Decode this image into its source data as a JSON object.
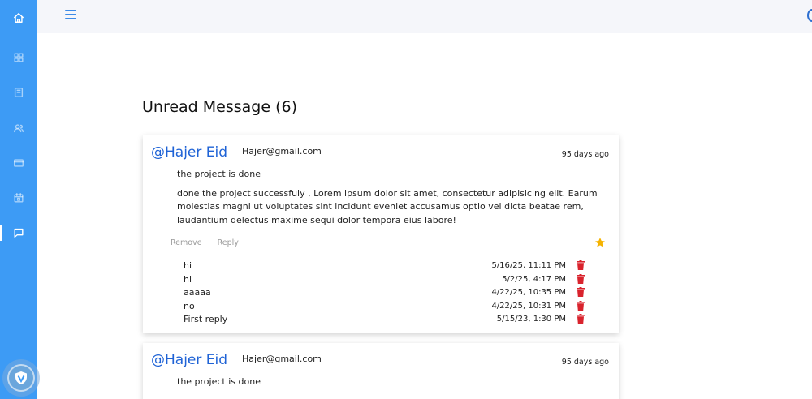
{
  "sidebar": {
    "items": [
      {
        "icon": "home-icon"
      },
      {
        "icon": "grid-icon"
      },
      {
        "icon": "book-icon"
      },
      {
        "icon": "users-icon"
      },
      {
        "icon": "card-icon"
      },
      {
        "icon": "calendar-icon"
      },
      {
        "icon": "message-icon"
      }
    ],
    "bottom_icon": "shield-icon",
    "accent": "#3d9bf5"
  },
  "page": {
    "title": "Unread Message (6)"
  },
  "messages": [
    {
      "username": "@Hajer Eid",
      "email": "Hajer@gmail.com",
      "ago": "95 days ago",
      "subject": "the project is done",
      "body": "done the project successfuly , Lorem ipsum dolor sit amet, consectetur adipisicing elit. Earum molestias magni ut voluptates sint incidunt eveniet accusamus optio vel dicta beatae rem, laudantium delectus maxime sequi dolor tempora eius labore!",
      "remove_label": "Remove",
      "reply_label": "Reply",
      "starred": true,
      "replies": [
        {
          "text": "hi",
          "date": "5/16/25, 11:11 PM"
        },
        {
          "text": "hi",
          "date": "5/2/25, 4:17 PM"
        },
        {
          "text": "aaaaa",
          "date": "4/22/25, 10:35 PM"
        },
        {
          "text": "no",
          "date": "4/22/25, 10:31 PM"
        },
        {
          "text": "First reply",
          "date": "5/15/23, 1:30 PM"
        }
      ]
    },
    {
      "username": "@Hajer Eid",
      "email": "Hajer@gmail.com",
      "ago": "95 days ago",
      "subject": "the project is done"
    }
  ],
  "colors": {
    "star": "#f5b301",
    "trash": "#d9232d",
    "link": "#1f63d6"
  }
}
